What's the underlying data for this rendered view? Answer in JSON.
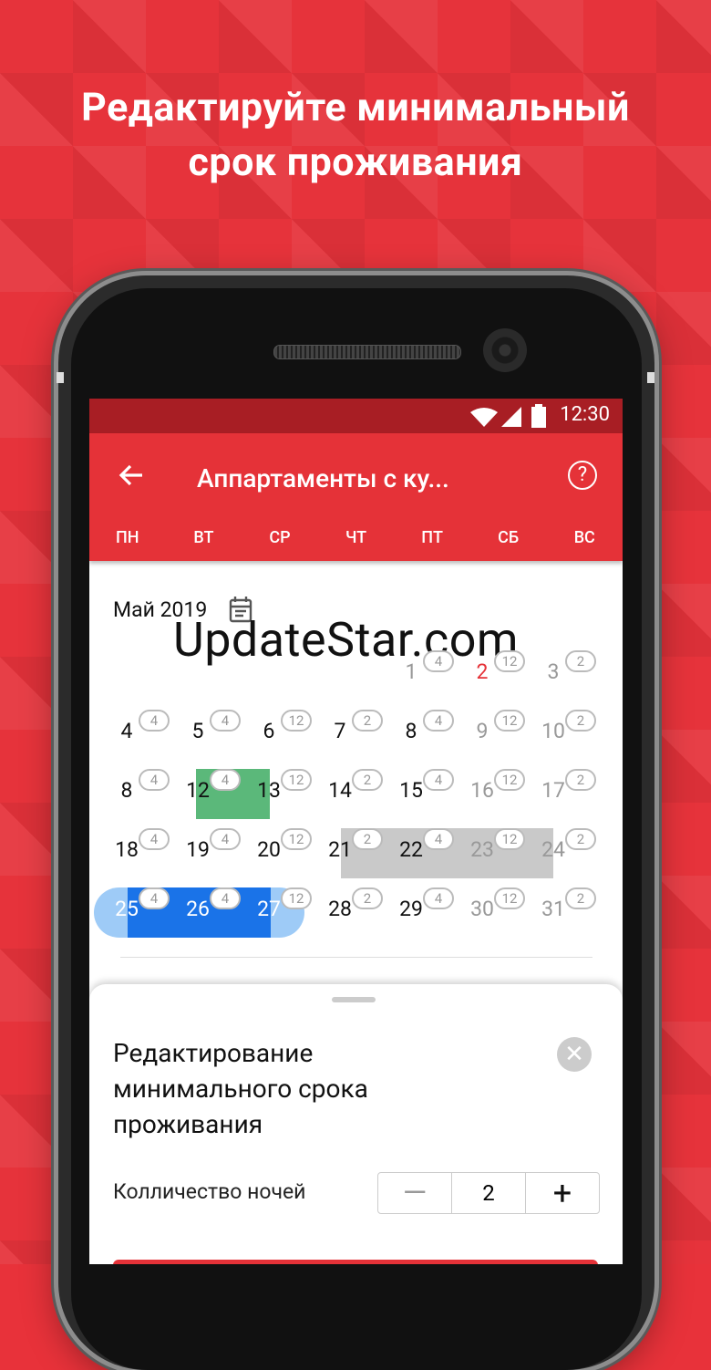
{
  "headline": {
    "line1": "Редактируйте минимальный",
    "line2": "срок проживания"
  },
  "status": {
    "time": "12:30"
  },
  "appbar": {
    "title": "Аппартаменты с ку...",
    "help_label": "?"
  },
  "weekdays": [
    "ПН",
    "ВТ",
    "СР",
    "ЧТ",
    "ПТ",
    "СБ",
    "ВС"
  ],
  "month_label": "Май 2019",
  "watermark": "UpdateStar.com",
  "calendar": {
    "rows": [
      [
        {
          "d": ""
        },
        {
          "d": ""
        },
        {
          "d": ""
        },
        {
          "d": ""
        },
        {
          "d": "1",
          "b": "4",
          "s": "muted"
        },
        {
          "d": "2",
          "b": "12",
          "s": "red"
        },
        {
          "d": "3",
          "b": "2",
          "s": "muted"
        }
      ],
      [
        {
          "d": "4",
          "b": "4"
        },
        {
          "d": "5",
          "b": "4"
        },
        {
          "d": "6",
          "b": "12"
        },
        {
          "d": "7",
          "b": "2"
        },
        {
          "d": "8",
          "b": "4"
        },
        {
          "d": "9",
          "b": "12",
          "s": "muted"
        },
        {
          "d": "10",
          "b": "2",
          "s": "muted"
        }
      ],
      [
        {
          "d": "8",
          "b": "4"
        },
        {
          "d": "12",
          "b": "4"
        },
        {
          "d": "13",
          "b": "12"
        },
        {
          "d": "14",
          "b": "2"
        },
        {
          "d": "15",
          "b": "4"
        },
        {
          "d": "16",
          "b": "12",
          "s": "muted"
        },
        {
          "d": "17",
          "b": "2",
          "s": "muted"
        }
      ],
      [
        {
          "d": "18",
          "b": "4"
        },
        {
          "d": "19",
          "b": "4"
        },
        {
          "d": "20",
          "b": "12"
        },
        {
          "d": "21",
          "b": "2"
        },
        {
          "d": "22",
          "b": "4"
        },
        {
          "d": "23",
          "b": "12",
          "s": "muted"
        },
        {
          "d": "24",
          "b": "2",
          "s": "muted"
        }
      ],
      [
        {
          "d": "25",
          "b": "4"
        },
        {
          "d": "26",
          "b": "4"
        },
        {
          "d": "27",
          "b": "12"
        },
        {
          "d": "28",
          "b": "2"
        },
        {
          "d": "29",
          "b": "4"
        },
        {
          "d": "30",
          "b": "12",
          "s": "muted"
        },
        {
          "d": "31",
          "b": "2",
          "s": "muted"
        }
      ]
    ]
  },
  "sheet": {
    "title": "Редактирование минимального срока проживания",
    "close_label": "✕",
    "nights_label": "Колличество ночей",
    "nights_value": "2",
    "minus_label": "—",
    "plus_label": "+"
  },
  "colors": {
    "accent": "#e53238",
    "status_bar": "#a81e24",
    "selected_blue": "#1a73e8",
    "booked_green": "#5bb87a",
    "blocked_gray": "#c9c9c9"
  }
}
